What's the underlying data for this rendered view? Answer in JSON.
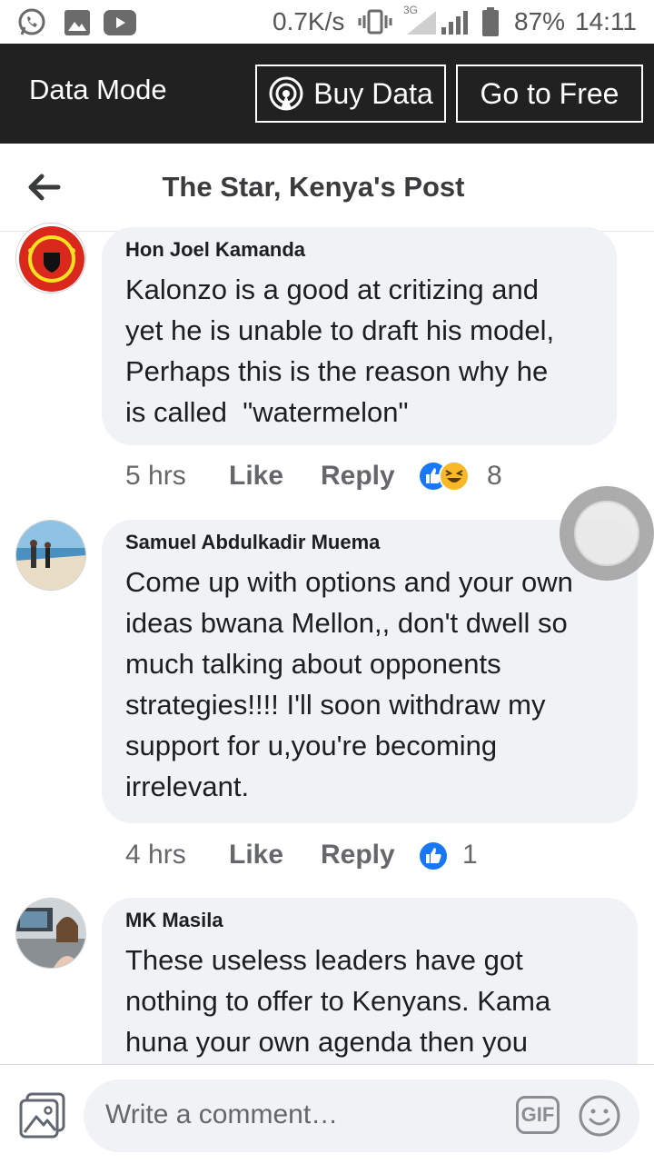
{
  "status_bar": {
    "net_speed": "0.7K/s",
    "network_type": "3G",
    "battery": "87%",
    "time": "14:11",
    "icons": [
      "whatsapp-icon",
      "gallery-icon",
      "youtube-icon",
      "vibrate-icon",
      "signal-icon",
      "battery-icon"
    ]
  },
  "data_bar": {
    "mode_label": "Data Mode",
    "buy_data_label": "Buy Data",
    "go_free_label": "Go to Free"
  },
  "header": {
    "title": "The Star, Kenya's Post"
  },
  "comments": [
    {
      "author": "Hon Joel Kamanda",
      "text_lines": [
        "Kalonzo is a good at critizing and",
        "yet he is unable to draft his model,",
        "Perhaps this is the reason why he",
        "is called  \"watermelon\""
      ],
      "time": "5 hrs",
      "like_label": "Like",
      "reply_label": "Reply",
      "reaction_count": "8",
      "reactions": [
        "like-reaction-icon",
        "haha-reaction-icon"
      ]
    },
    {
      "author": "Samuel Abdulkadir Muema",
      "text_lines": [
        "Come up with options and your own",
        "ideas bwana Mellon,, don't dwell so",
        "much talking about opponents",
        "strategies!!!! I'll soon withdraw my",
        "support for u,you're becoming",
        "irrelevant."
      ],
      "time": "4 hrs",
      "like_label": "Like",
      "reply_label": "Reply",
      "reaction_count": "1",
      "reactions": [
        "like-reaction-icon"
      ]
    },
    {
      "author": "MK Masila",
      "text_lines": [
        "These useless leaders have got",
        "nothing to offer to Kenyans. Kama",
        "huna your own agenda then you"
      ]
    }
  ],
  "composer": {
    "placeholder": "Write a comment…",
    "gif_label": "GIF"
  },
  "colors": {
    "data_bar_bg": "#212121",
    "bubble_bg": "#f0f2f5",
    "like_blue": "#1877f2",
    "haha_yellow": "#f7b928"
  }
}
